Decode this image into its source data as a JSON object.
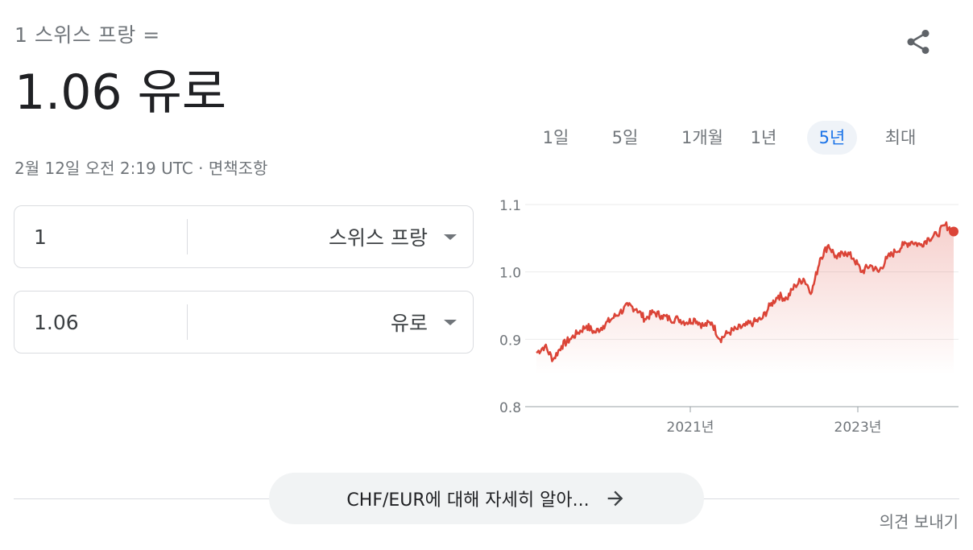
{
  "header": {
    "subtitle": "1 스위스 프랑 =",
    "result": "1.06 유로",
    "timestamp": "2월 12일 오전 2:19 UTC · ",
    "disclaimer": "면책조항",
    "share_icon": "share-icon"
  },
  "converter": {
    "from": {
      "amount": "1",
      "currency": "스위스 프랑"
    },
    "to": {
      "amount": "1.06",
      "currency": "유로"
    }
  },
  "ranges": {
    "items": [
      "1일",
      "5일",
      "1개월",
      "1년",
      "5년",
      "최대"
    ],
    "active": "5년"
  },
  "chart_data": {
    "type": "area",
    "ylim": [
      0.8,
      1.1
    ],
    "yticks": [
      "1.1",
      "1.0",
      "0.9",
      "0.8"
    ],
    "xtick_labels": [
      "2021년",
      "2023년"
    ],
    "line_color": "#db4437",
    "series": [
      {
        "x_start": "2019-02",
        "x_end": "2024-02",
        "values": [
          0.88,
          0.89,
          0.87,
          0.89,
          0.9,
          0.91,
          0.92,
          0.91,
          0.92,
          0.93,
          0.94,
          0.95,
          0.945,
          0.93,
          0.94,
          0.935,
          0.93,
          0.93,
          0.925,
          0.93,
          0.92,
          0.925,
          0.9,
          0.91,
          0.915,
          0.92,
          0.925,
          0.93,
          0.95,
          0.965,
          0.96,
          0.98,
          0.99,
          0.97,
          1.02,
          1.04,
          1.02,
          1.03,
          1.02,
          1.0,
          1.01,
          1.0,
          1.02,
          1.03,
          1.04,
          1.045,
          1.04,
          1.05,
          1.055,
          1.07,
          1.06
        ]
      }
    ],
    "last_value": 1.06
  },
  "footer": {
    "more_link": "CHF/EUR에 대해 자세히 알아...",
    "feedback": "의견 보내기"
  }
}
